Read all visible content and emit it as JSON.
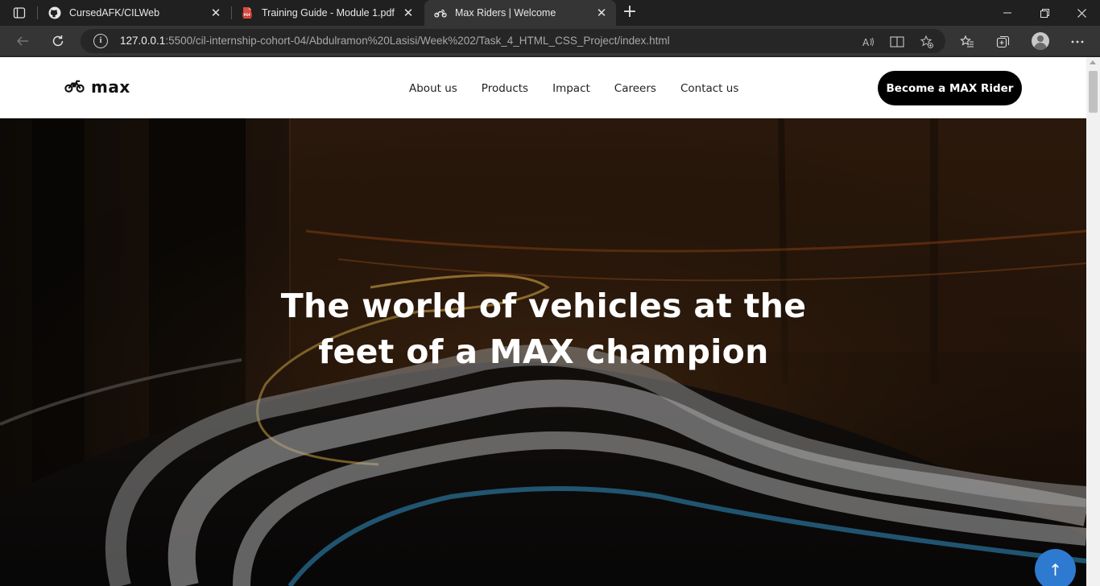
{
  "browser": {
    "tabs": [
      {
        "title": "CursedAFK/CILWeb",
        "icon": "github-icon",
        "active": false
      },
      {
        "title": "Training Guide - Module 1.pdf",
        "icon": "pdf-icon",
        "active": false
      },
      {
        "title": "Max Riders | Welcome",
        "icon": "motorcycle-icon",
        "active": true
      }
    ],
    "url_host": "127.0.0.1",
    "url_path": ":5500/cil-internship-cohort-04/Abdulramon%20Lasisi/Week%202/Task_4_HTML_CSS_Project/index.html"
  },
  "site": {
    "logo_text": "max",
    "nav": [
      "About us",
      "Products",
      "Impact",
      "Careers",
      "Contact us"
    ],
    "cta_label": "Become a MAX Rider",
    "hero_title_line1": "The world of vehicles at the",
    "hero_title_line2": "feet of a MAX champion",
    "scroll_top_label": "↑"
  },
  "colors": {
    "cta_bg": "#000000",
    "scroll_top_bg": "#2e7ad1"
  }
}
